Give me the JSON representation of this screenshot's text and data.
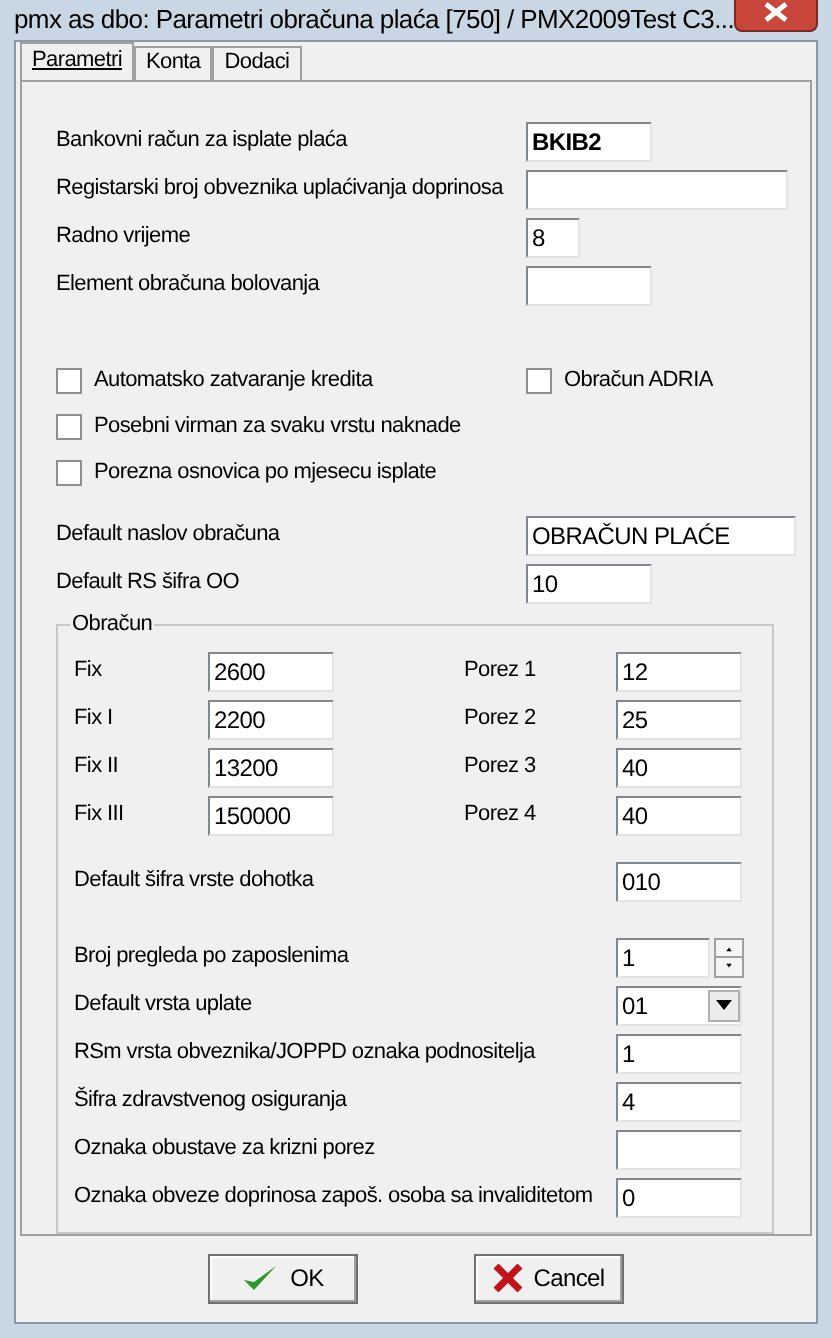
{
  "window": {
    "title": "pmx as dbo: Parametri  obračuna plaća [750] / PMX2009Test C3..."
  },
  "tabs": [
    {
      "label": "Parametri",
      "selected": true
    },
    {
      "label": "Konta",
      "selected": false
    },
    {
      "label": "Dodaci",
      "selected": false
    }
  ],
  "top_fields": [
    {
      "label": "Bankovni račun za isplate plaća",
      "value": "BKIB2",
      "bold": true
    },
    {
      "label": "Registarski broj obveznika uplaćivanja doprinosa"
    },
    {
      "label": "Radno vrijeme",
      "value": "8"
    },
    {
      "label": "Element obračuna bolovanja"
    }
  ],
  "checkbox_rows": [
    [
      {
        "label": "Automatsko zatvaranje kredita",
        "checked": false
      },
      {
        "label": "Obračun ADRIA",
        "checked": false
      }
    ],
    [
      {
        "label": "Posebni virman za svaku vrstu naknade",
        "checked": false
      }
    ],
    [
      {
        "label": "Porezna osnovica po mjesecu isplate",
        "checked": false
      }
    ]
  ],
  "mid_fields": [
    {
      "label": "Default naslov obračuna",
      "value": "OBRAČUN PLAĆE"
    },
    {
      "label": "Default RS šifra OO",
      "value": "10"
    }
  ],
  "group": {
    "title": "Obračun",
    "rows": [
      {
        "label": "Fix",
        "value": "2600",
        "porez_label": "Porez 1",
        "porez_value": "12"
      },
      {
        "label": "Fix I",
        "value": "2200",
        "porez_label": "Porez 2",
        "porez_value": "25"
      },
      {
        "label": "Fix II",
        "value": "13200",
        "porez_label": "Porez 3",
        "porez_value": "40"
      },
      {
        "label": "Fix III",
        "value": "150000",
        "porez_label": "Porez 4",
        "porez_value": "40"
      }
    ],
    "income_code": {
      "label": "Default šifra vrste dohotka",
      "value": "010"
    },
    "fields": [
      {
        "kind": "spin",
        "label": "Broj pregleda po zaposlenima",
        "value": "1"
      },
      {
        "kind": "dropdown",
        "label": "Default vrsta uplate",
        "value": "01"
      },
      {
        "kind": "text",
        "label": "RSm vrsta obveznika/JOPPD oznaka podnositelja",
        "value": "1"
      },
      {
        "kind": "text",
        "label": "Šifra zdravstvenog osiguranja",
        "value": "4"
      },
      {
        "kind": "text",
        "label": "Oznaka obustave za krizni porez"
      },
      {
        "kind": "text",
        "label": "Oznaka obveze doprinosa zapoš. osoba sa invaliditetom",
        "value": "0"
      }
    ]
  },
  "buttons": [
    {
      "kind": "ok",
      "label": "OK"
    },
    {
      "kind": "cancel",
      "label": "Cancel"
    }
  ]
}
